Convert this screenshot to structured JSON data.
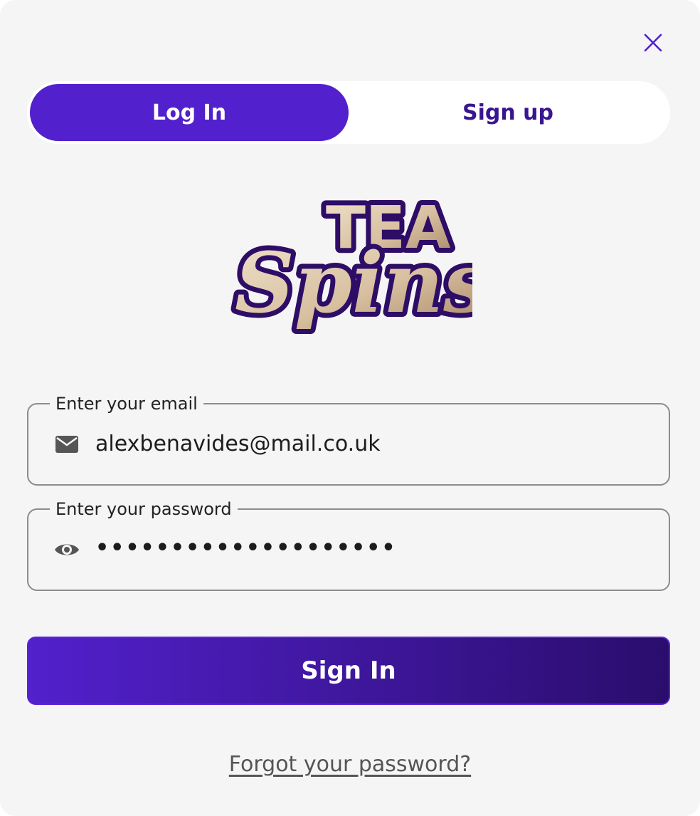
{
  "colors": {
    "accent": "#5220cc",
    "accent_dark": "#2a0d6c",
    "signup_text": "#3a1590",
    "modal_bg": "#f5f5f6",
    "logo_gold_light": "#ecdcc4",
    "logo_gold_dark": "#a88868",
    "logo_outline": "#2e0d66"
  },
  "modal": {
    "close_icon": "close-icon"
  },
  "tabs": [
    {
      "label": "Log In",
      "active": true
    },
    {
      "label": "Sign up",
      "active": false
    }
  ],
  "logo": {
    "line1": "TEA",
    "line2": "Spins"
  },
  "email": {
    "label": "Enter your email",
    "value": "alexbenavides@mail.co.uk",
    "icon": "envelope-icon"
  },
  "password": {
    "label": "Enter your password",
    "value": "••••••••••••••••••••",
    "icon": "eye-icon"
  },
  "actions": {
    "submit_label": "Sign In",
    "forgot_label": "Forgot your password?"
  }
}
